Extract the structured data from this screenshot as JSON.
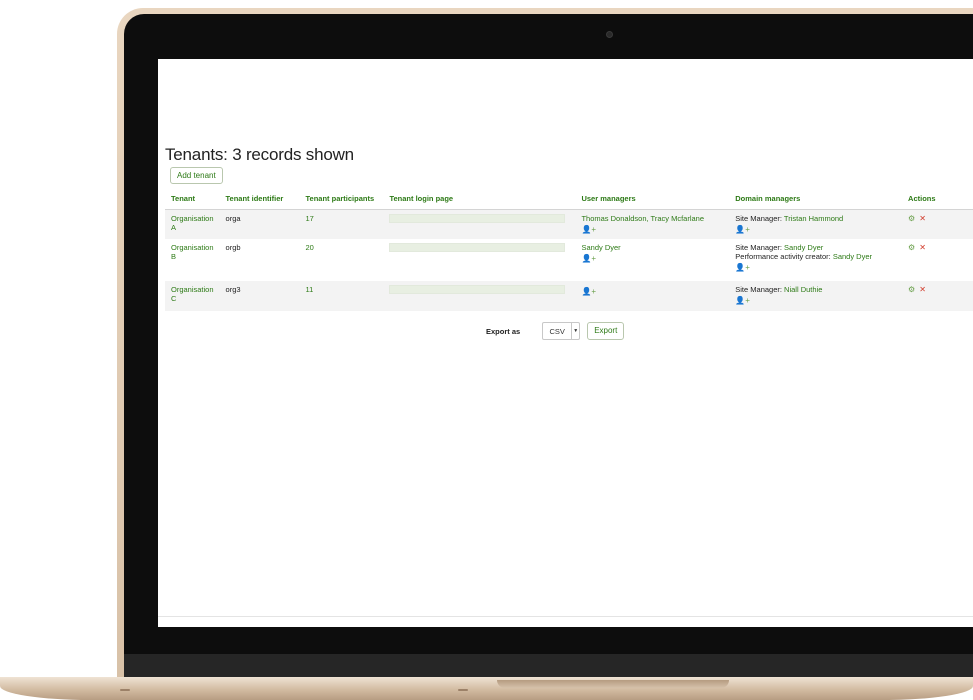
{
  "page": {
    "title": "Tenants: 3 records shown",
    "add_tenant_label": "Add tenant"
  },
  "table": {
    "columns": [
      "Tenant",
      "Tenant identifier",
      "Tenant participants",
      "Tenant login page",
      "User managers",
      "Domain managers",
      "Actions"
    ],
    "rows": [
      {
        "tenant": "Organisation A",
        "identifier": "orga",
        "participants": "17",
        "user_managers": "Thomas Donaldson, Tracy Mcfarlane",
        "domain_label_1": "Site Manager: ",
        "domain_value_1": "Tristan Hammond"
      },
      {
        "tenant": "Organisation B",
        "identifier": "orgb",
        "participants": "20",
        "user_managers": "Sandy Dyer",
        "domain_label_1": "Site Manager: ",
        "domain_value_1": "Sandy Dyer",
        "domain_label_2": "Performance activity creator: ",
        "domain_value_2": "Sandy Dyer"
      },
      {
        "tenant": "Organisation C",
        "identifier": "org3",
        "participants": "11",
        "user_managers": "",
        "domain_label_1": "Site Manager: ",
        "domain_value_1": "Niall Duthie"
      }
    ]
  },
  "export": {
    "label": "Export as",
    "format": "CSV",
    "button_label": "Export"
  },
  "icons": {
    "assign": "👤+",
    "settings": "⚙",
    "delete": "✕"
  },
  "colors": {
    "accent": "#2d7a16",
    "delete": "#d23b2b"
  }
}
